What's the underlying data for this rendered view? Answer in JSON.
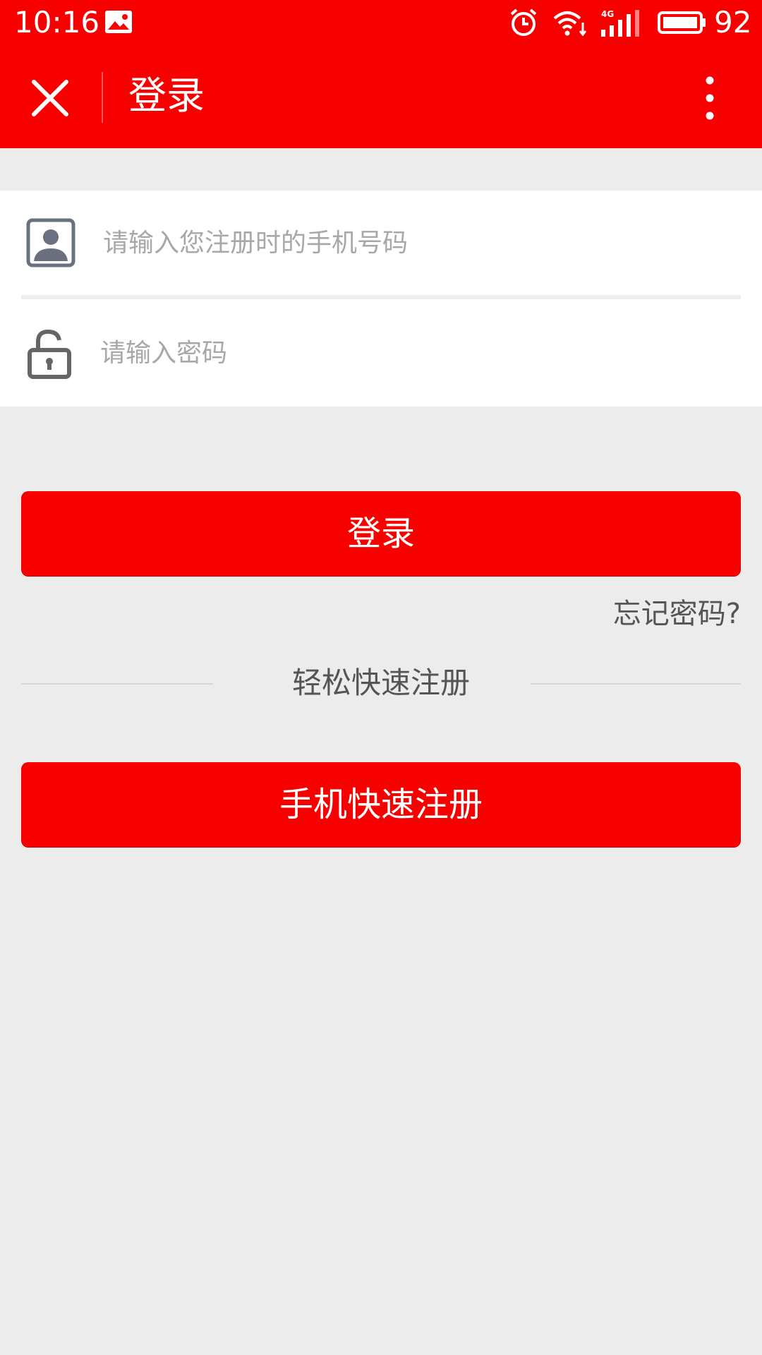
{
  "status_bar": {
    "time": "10:16",
    "battery_percent": "92",
    "icons": [
      "gallery-icon",
      "alarm-icon",
      "wifi-icon",
      "signal-4g-icon",
      "battery-icon"
    ],
    "color": "#f70000"
  },
  "app_bar": {
    "title": "登录",
    "close_icon": "close-icon",
    "more_icon": "more-vertical-icon"
  },
  "form": {
    "phone": {
      "placeholder": "请输入您注册时的手机号码",
      "value": "",
      "icon": "user-portrait-icon"
    },
    "password": {
      "placeholder": "请输入密码",
      "value": "",
      "icon": "unlocked-padlock-icon"
    }
  },
  "actions": {
    "login_label": "登录",
    "forgot_label": "忘记密码?",
    "divider_label": "轻松快速注册",
    "register_label": "手机快速注册"
  },
  "colors": {
    "accent": "#f70000",
    "background": "#ececec",
    "placeholder": "#a8a8a8"
  }
}
